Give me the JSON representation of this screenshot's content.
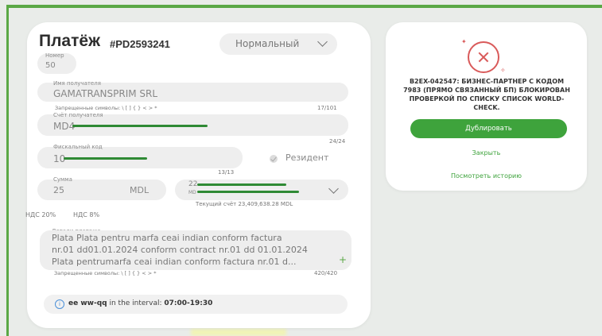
{
  "payment": {
    "title": "Платёж",
    "id": "#PD2593241",
    "priority": "Нормальный"
  },
  "fields": {
    "number": {
      "label": "Номер",
      "value": "50"
    },
    "recipient": {
      "label": "Имя получателя",
      "value": "GAMATRANSPRIM SRL",
      "hint": "Запрещенные символы: \\ [ ] { } < > *",
      "count": "17/101"
    },
    "account": {
      "label": "Счёт получателя",
      "value": "MD4",
      "count": "24/24"
    },
    "fiscal": {
      "label": "Фискальный код",
      "value": "10",
      "count": "13/13"
    },
    "resident": "Резидент",
    "amount": {
      "label": "Сумма",
      "value": "25",
      "currency": "MDL"
    },
    "source_account": {
      "value_prefix": "22",
      "sub_prefix": "MD",
      "balance": "Текущий счёт 23,409,638.28 MDL"
    },
    "vat": [
      "НДС 20%",
      "НДС 8%"
    ],
    "details": {
      "label": "Детали платежа",
      "lines": [
        "Plata Plata pentru marfa ceai indian conform factura",
        "nr.01 dd01.01.2024 conform contract nr.01 dd 01.01.2024",
        "Plata pentrumarfa ceai indian conform factura nr.01 d..."
      ],
      "hint": "Запрещенные символы: \\ [ ] { } < > *",
      "count": "420/420"
    }
  },
  "notice": {
    "bold": "ee ww-qq",
    "text": "in the interval:",
    "time": "07:00-19:30"
  },
  "side": {
    "message": "B2EX-042547: БИЗНЕС-ПАРТНЕР С КОДОМ 7983 (ПРЯМО СВЯЗАННЫЙ БП) БЛОКИРОВАН ПРОВЕРКОЙ ПО СПИСКУ СПИСОК WORLD-CHECK.",
    "duplicate": "Дублировать",
    "close": "Закрыть",
    "history": "Посмотреть историю"
  },
  "colors": {
    "accent": "#3ea33c",
    "error": "#d95a5a",
    "field_bg": "#eeeeee"
  }
}
